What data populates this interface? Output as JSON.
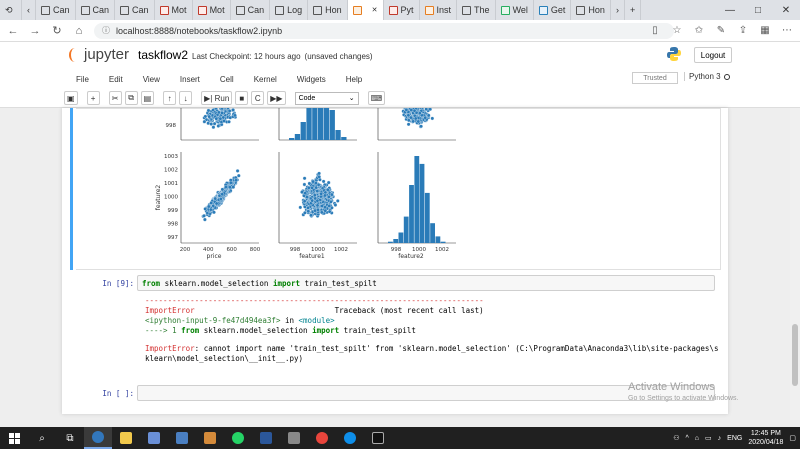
{
  "browser": {
    "tabs": [
      {
        "label": "Can",
        "icon": "page-icon"
      },
      {
        "label": "Can",
        "icon": "page-icon"
      },
      {
        "label": "Can",
        "icon": "page-icon"
      },
      {
        "label": "Mot",
        "icon": "red-icon"
      },
      {
        "label": "Mot",
        "icon": "red-icon"
      },
      {
        "label": "Can",
        "icon": "page-icon"
      },
      {
        "label": "Log",
        "icon": "page-icon"
      },
      {
        "label": "Hon",
        "icon": "page-icon"
      },
      {
        "label": "",
        "icon": "jupyter-icon",
        "active": true
      },
      {
        "label": "Pyt",
        "icon": "red-icon"
      },
      {
        "label": "Inst",
        "icon": "orange-icon"
      },
      {
        "label": "The",
        "icon": "page-icon"
      },
      {
        "label": "Wel",
        "icon": "green-icon"
      },
      {
        "label": "Get",
        "icon": "blue-icon"
      },
      {
        "label": "Hon",
        "icon": "page-icon"
      }
    ],
    "url": "localhost:8888/notebooks/taskflow2.ipynb",
    "new_tab": "+",
    "controls": {
      "minimize": "—",
      "maximize": "□",
      "close": "✕"
    }
  },
  "jupyter": {
    "logo_text": "jupyter",
    "notebook_name": "taskflow2",
    "checkpoint": "Last Checkpoint: 12 hours ago",
    "unsaved": "(unsaved changes)",
    "logout": "Logout",
    "menu": [
      "File",
      "Edit",
      "View",
      "Insert",
      "Cell",
      "Kernel",
      "Widgets",
      "Help"
    ],
    "trusted": "Trusted",
    "kernel": "Python 3",
    "run_label": "Run",
    "cell_type": "Code"
  },
  "chart_data": {
    "type": "scatter",
    "description_source": "seaborn pairplot (partial view)",
    "row_labels": [
      "feature2"
    ],
    "col_labels": [
      "price",
      "feature1",
      "feature2"
    ],
    "top_row_ytick": "998",
    "y_ticks": [
      "1003",
      "1002",
      "1001",
      "1000",
      "999",
      "998",
      "997"
    ],
    "x_ticks_price": [
      "200",
      "400",
      "600",
      "800"
    ],
    "x_ticks_feature1": [
      "998",
      "1000",
      "1002"
    ],
    "x_ticks_feature2": [
      "998",
      "1000",
      "1002"
    ],
    "hist_feature2": [
      1,
      3,
      8,
      20,
      44,
      66,
      60,
      38,
      15,
      5,
      1
    ],
    "color": "#2a7bb8"
  },
  "cells": {
    "cell9": {
      "prompt": "In [9]:",
      "code_from": "from",
      "code_mod": " sklearn.model_selection ",
      "code_import": "import",
      "code_rest": " train_test_spilt"
    },
    "error": {
      "dashes": "---------------------------------------------------------------------------",
      "name": "ImportError",
      "traceback": "Traceback (most recent call last)",
      "location_a": "<ipython-input-9-fe47d494ea3f>",
      "location_b": " in ",
      "location_c": "<module>",
      "arrow": "----> 1 ",
      "line_a": "from",
      "line_b": " sklearn.model_selection ",
      "line_c": "import",
      "line_d": " train_test_spilt",
      "msg_name": "ImportError",
      "msg_1": ": cannot import name 'train_test_spilt' from 'sklearn.model_selection' (C:\\ProgramData\\Anaconda3\\lib\\site-packages\\s",
      "msg_2": "klearn\\model_selection\\__init__.py)"
    },
    "empty_prompt": "In [ ]:"
  },
  "watermark": {
    "line1": "Activate Windows",
    "line2": "Go to Settings to activate Windows."
  },
  "taskbar": {
    "lang": "ENG",
    "time": "12:45 PM",
    "date": "2020/04/18"
  }
}
